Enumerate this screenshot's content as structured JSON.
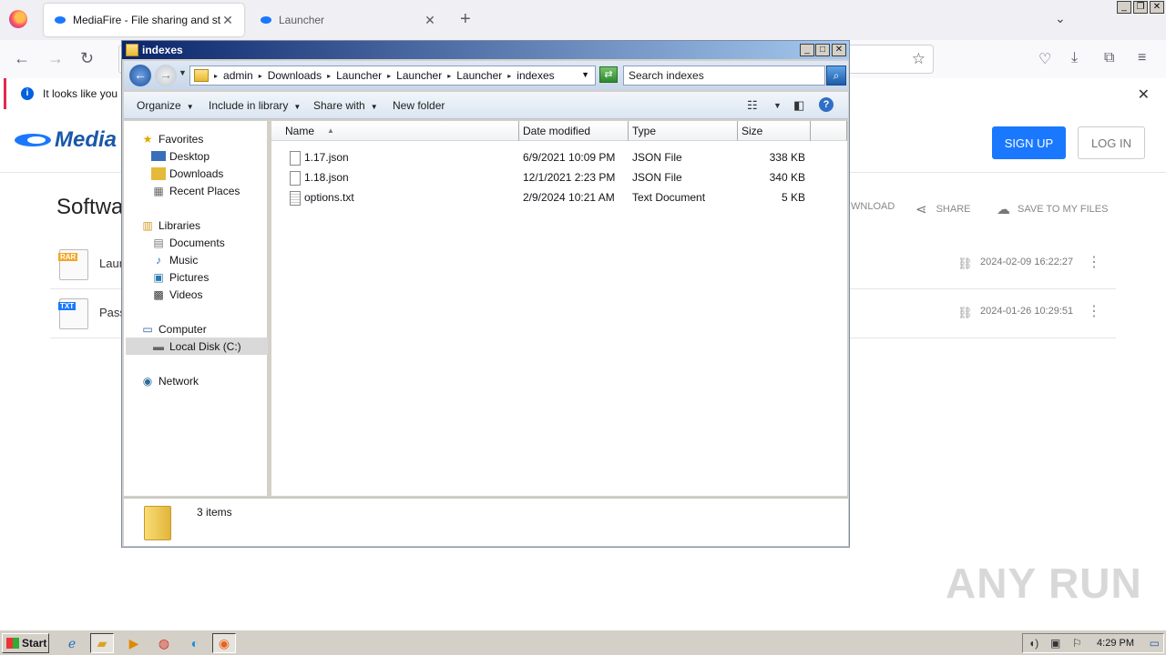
{
  "browser": {
    "tabs": [
      {
        "title": "MediaFire - File sharing and storag"
      },
      {
        "title": "Launcher"
      }
    ],
    "infobar_text": "It looks like you ha"
  },
  "mediafire": {
    "logo": "Media",
    "signup": "SIGN UP",
    "login": "LOG IN",
    "heading": "Softwa",
    "actions": {
      "download": "WNLOAD",
      "share": "SHARE",
      "save": "SAVE TO MY FILES"
    },
    "files": [
      {
        "badge": "RAR",
        "badge_color": "#f5a623",
        "name": "Laur",
        "date": "2024-02-09 16:22:27"
      },
      {
        "badge": "TXT",
        "badge_color": "#1a78ff",
        "name": "Pass",
        "date": "2024-01-26 10:29:51"
      }
    ]
  },
  "explorer": {
    "title": "indexes",
    "breadcrumbs": [
      "admin",
      "Downloads",
      "Launcher",
      "Launcher",
      "Launcher",
      "indexes"
    ],
    "search_placeholder": "Search indexes",
    "toolbar": {
      "organize": "Organize",
      "include": "Include in library",
      "share": "Share with",
      "newfolder": "New folder"
    },
    "nav": {
      "favorites": "Favorites",
      "desktop": "Desktop",
      "downloads": "Downloads",
      "recent": "Recent Places",
      "libraries": "Libraries",
      "documents": "Documents",
      "music": "Music",
      "pictures": "Pictures",
      "videos": "Videos",
      "computer": "Computer",
      "localdisk": "Local Disk (C:)",
      "network": "Network"
    },
    "columns": {
      "name": "Name",
      "date": "Date modified",
      "type": "Type",
      "size": "Size"
    },
    "files": [
      {
        "name": "1.17.json",
        "date": "6/9/2021 10:09 PM",
        "type": "JSON File",
        "size": "338 KB"
      },
      {
        "name": "1.18.json",
        "date": "12/1/2021 2:23 PM",
        "type": "JSON File",
        "size": "340 KB"
      },
      {
        "name": "options.txt",
        "date": "2/9/2024 10:21 AM",
        "type": "Text Document",
        "size": "5 KB"
      }
    ],
    "status": "3 items"
  },
  "taskbar": {
    "start": "Start",
    "clock": "4:29 PM"
  },
  "watermark": "ANY RUN"
}
